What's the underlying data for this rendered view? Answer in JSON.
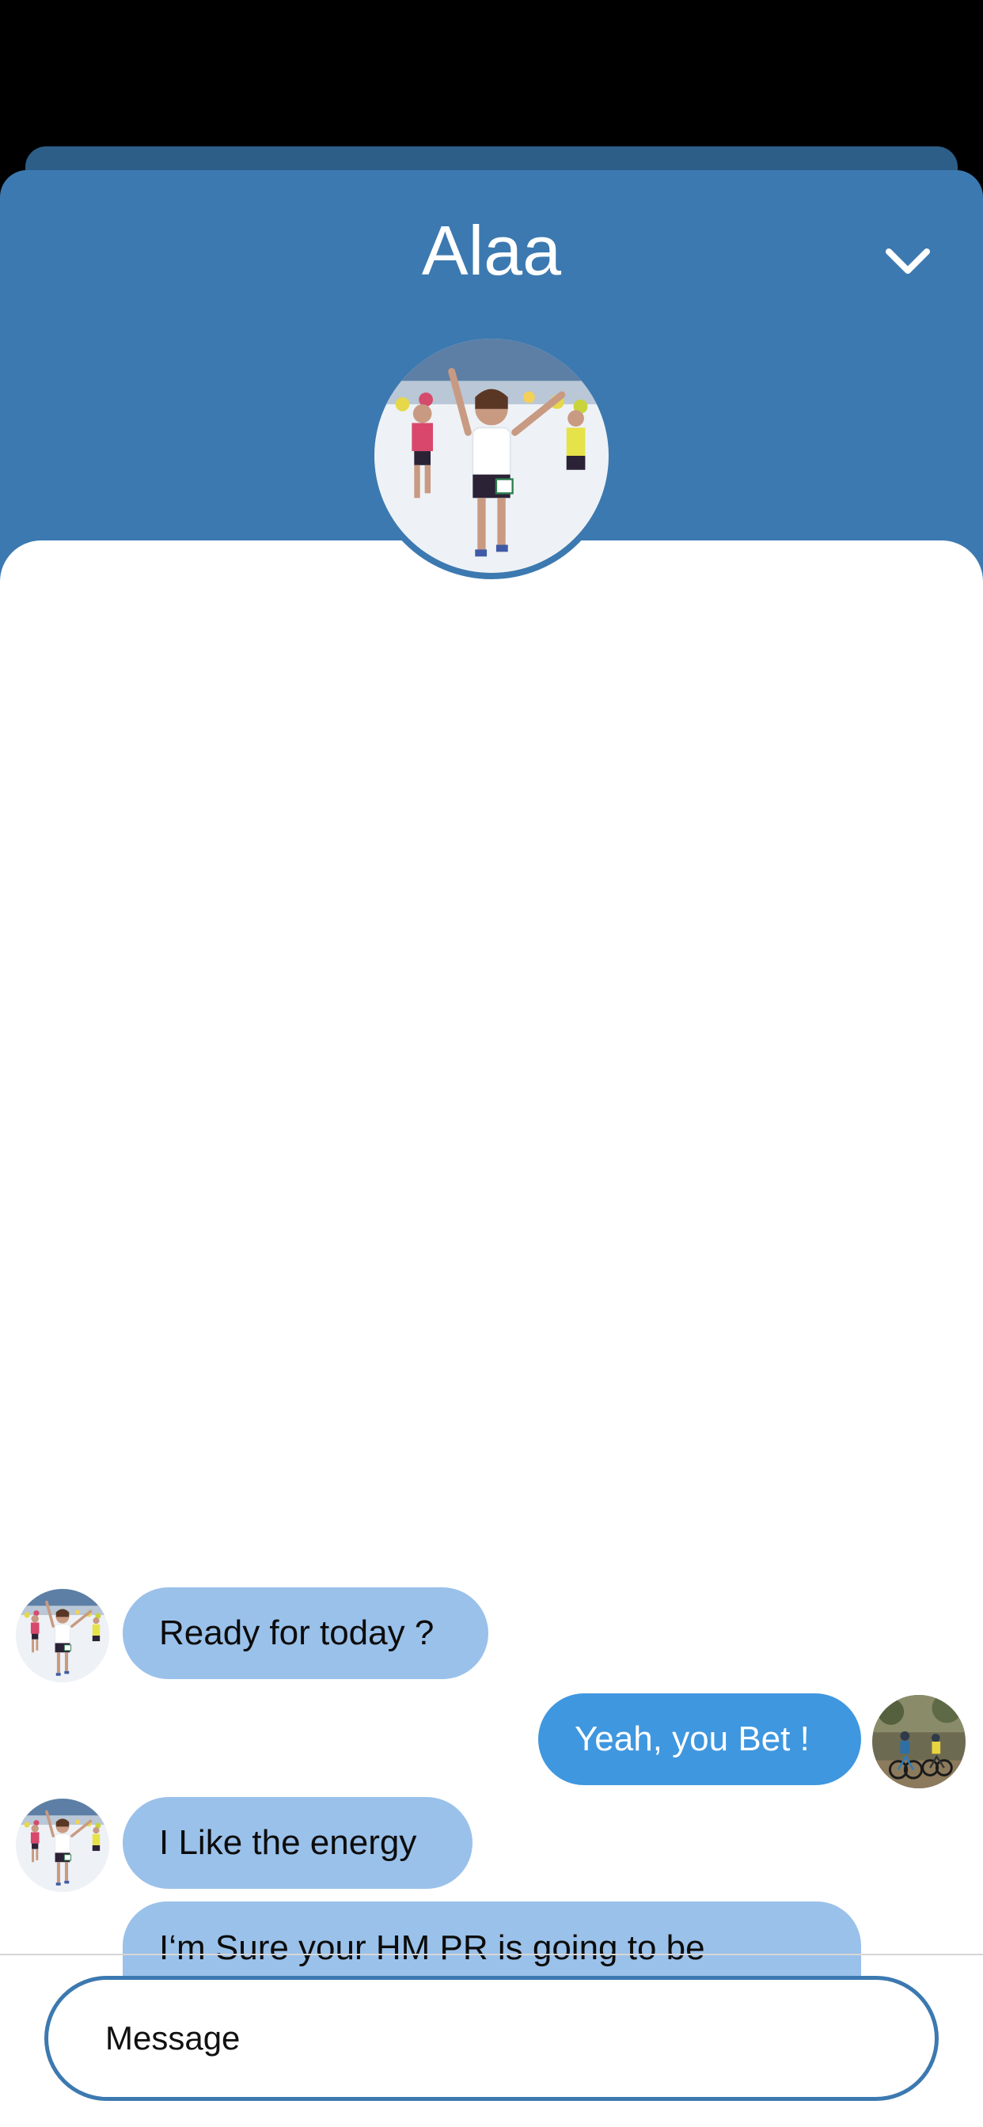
{
  "header": {
    "title": "Alaa",
    "collapse_icon": "chevron-down-icon"
  },
  "colors": {
    "header_bg": "#3C79B0",
    "back_card": "#2D5E88",
    "incoming_bubble": "#9AC1EA",
    "outgoing_bubble": "#3F97DF",
    "input_border": "#3C79B0"
  },
  "messages": [
    {
      "direction": "incoming",
      "text": "Ready for today ?"
    },
    {
      "direction": "outgoing",
      "text": "Yeah, you Bet !"
    },
    {
      "direction": "incoming",
      "text": "I Like the energy"
    },
    {
      "direction": "incoming",
      "text": "I‘m Sure your HM PR is going to be destroyed this year !"
    }
  ],
  "composer": {
    "placeholder": "Message",
    "value": ""
  }
}
